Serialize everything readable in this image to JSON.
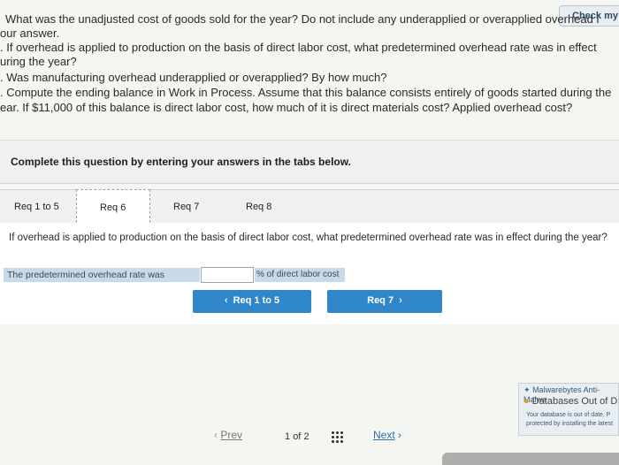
{
  "header": {
    "check_button": "Check my"
  },
  "question_lines": [
    "What was the unadjusted cost of goods sold for the year? Do not include any underapplied or overapplied overhead i",
    "our answer.",
    ". If overhead is applied to production on the basis of direct labor cost, what predetermined overhead rate was in effect",
    "uring the year?",
    ". Was manufacturing overhead underapplied or overapplied? By how much?",
    ". Compute the ending balance in Work in Process. Assume that this balance consists entirely of goods started during the",
    "ear. If $11,000 of this balance is direct labor cost, how much of it is direct materials cost? Applied overhead cost?"
  ],
  "instructions": "Complete this question by entering your answers in the tabs below.",
  "tabs": [
    {
      "label": "Req 1 to 5"
    },
    {
      "label": "Req 6"
    },
    {
      "label": "Req 7"
    },
    {
      "label": "Req 8"
    }
  ],
  "panel": {
    "question": "If overhead is applied to production on the basis of direct labor cost, what predetermined overhead rate was in effect during the year?",
    "answer_label": "The predetermined overhead rate was",
    "answer_value": "",
    "answer_unit": "% of direct labor cost"
  },
  "nav": {
    "prev_label": "Req 1 to 5",
    "next_label": "Req 7"
  },
  "pager": {
    "prev": "Prev",
    "current": "1",
    "of": "of",
    "total": "2",
    "next": "Next"
  },
  "popup": {
    "title": "Malwarebytes Anti-Malwa",
    "heading": "Databases Out of D",
    "line1": "Your database is out of date. P",
    "line2": "protected by installing the latest"
  }
}
